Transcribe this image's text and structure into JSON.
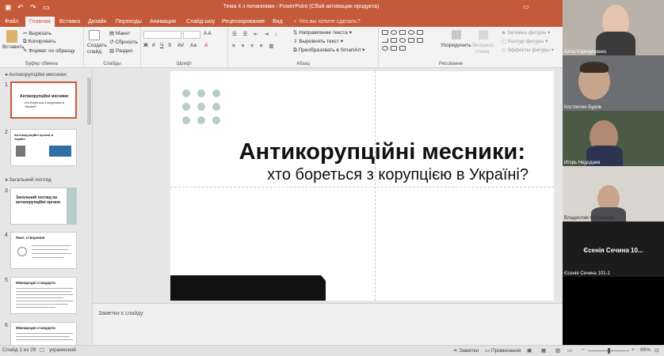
{
  "titlebar": {
    "title": "Тема 4 з питаннями - PowerPoint (Сбой активации продукта)"
  },
  "tabs": [
    "Файл",
    "Главная",
    "Вставка",
    "Дизайн",
    "Переходы",
    "Анимация",
    "Слайд-шоу",
    "Рецензирование",
    "Вид"
  ],
  "tell_me": "Что вы хотите сделать?",
  "ribbon": {
    "paste": "Вставить",
    "cut": "Вырезать",
    "copy": "Копировать",
    "format_painter": "Формат по образцу",
    "clipboard": "Буфер обмена",
    "new_slide_1": "Создать",
    "new_slide_2": "слайд",
    "layout": "Макет",
    "reset": "Сбросить",
    "section": "Раздел",
    "slides": "Слайды",
    "font": "Шрифт",
    "paragraph": "Абзац",
    "text_direction": "Направление текста",
    "align_text": "Выровнять текст",
    "smartart": "Преобразовать в SmartArt",
    "arrange": "Упорядочить",
    "quick_styles_1": "Экспресс-",
    "quick_styles_2": "стили",
    "shape_fill": "Заливка фигуры",
    "shape_outline": "Контур фигуры",
    "shape_effects": "Эффекты фигуры",
    "drawing": "Рисование"
  },
  "sections": {
    "first": "Антикорупційні месники:",
    "second": "Загальний погляд"
  },
  "thumbs": {
    "s1_title": "Антикорупційні месники:",
    "s1_sub": "хто бореться з корупцією в Україні?",
    "s2_title": "Антикорупційні органи в Україні",
    "s3_title": "Загальний погляд на антикорупційні органи",
    "s4_title": "Факт. створення",
    "s5_title": "Міжнародні стандарти",
    "s6_title": "Міжнародні стандарти"
  },
  "slide_numbers": [
    "1",
    "2",
    "3",
    "4",
    "5",
    "6"
  ],
  "slide": {
    "title": "Антикорупційні месники:",
    "subtitle": "хто бореться з корупцією в Україні?"
  },
  "notes_placeholder": "Заметки к слайду",
  "status": {
    "slide_count": "Слайд 1 из 29",
    "language": "украинский",
    "notes": "Заметки",
    "comments": "Примечания",
    "zoom": "95%"
  },
  "participants": [
    {
      "name": "Алла Карнаушенко"
    },
    {
      "name": "Костянтин Буров"
    },
    {
      "name": "Игорь Недодаев"
    },
    {
      "name": "Владислав Єрьоменко"
    },
    {
      "name": "Єсенія Сечина 101-1",
      "big": "Єсенія Сечина 10..."
    }
  ],
  "colors": {
    "accent": "#c55a3b",
    "dots": "#b8cccc"
  }
}
